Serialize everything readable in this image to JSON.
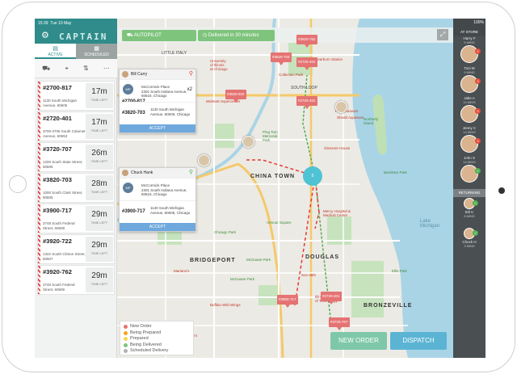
{
  "status": {
    "time": "15:39",
    "date": "Tue 10 May",
    "battery": "100%"
  },
  "brand": {
    "title": "CAPTAIN"
  },
  "tabs": [
    {
      "label": "ACTIVE"
    },
    {
      "label": "SCHEDULED"
    }
  ],
  "orders": [
    {
      "id": "#2700-817",
      "address": "1130 South Michigan Avenue, 60605",
      "mins": "17m",
      "time_left": "TIME LEFT"
    },
    {
      "id": "#2720-401",
      "address": "3700-3706 South Calumet Avenue, 60653",
      "mins": "17m",
      "time_left": "TIME LEFT"
    },
    {
      "id": "#3720-707",
      "address": "1200 South State Street, 60605",
      "mins": "26m",
      "time_left": "TIME LEFT"
    },
    {
      "id": "#3820-703",
      "address": "1000 South Clark Street, 60605",
      "mins": "28m",
      "time_left": "TIME LEFT"
    },
    {
      "id": "#3900-717",
      "address": "3748 South Federal Street, 60609",
      "mins": "29m",
      "time_left": "TIME LEFT"
    },
    {
      "id": "#3920-722",
      "address": "1322 South Clinton Street, 60607",
      "mins": "29m",
      "time_left": "TIME LEFT"
    },
    {
      "id": "#3920-762",
      "address": "3748 South Federal Street, 60609",
      "mins": "29m",
      "time_left": "TIME LEFT"
    }
  ],
  "topbar": {
    "autopilot": "AUTOPILOT",
    "delivered": "Delivered in 30 minutes"
  },
  "popovers": [
    {
      "driver": "Bill Curry",
      "rows": [
        {
          "id": "#2700-817",
          "badge": "MP",
          "place": "McCormick Place",
          "line1": "2301 South Indiana Avenue,",
          "line2": "60616, Chicago",
          "count": "x2"
        },
        {
          "id": "#3820-703",
          "badge": "",
          "place": "",
          "line1": "1130 South Michigan",
          "line2": "Avenue, 60605, Chicago",
          "count": ""
        }
      ],
      "accept": "ACCEPT"
    },
    {
      "driver": "Chuck Hank",
      "rows": [
        {
          "id": "",
          "badge": "MP",
          "place": "McCormick Place",
          "line1": "2301 South Indiana Avenue,",
          "line2": "60616, Chicago",
          "count": ""
        },
        {
          "id": "#3900-717",
          "badge": "",
          "place": "",
          "line1": "1130 South Michigan",
          "line2": "Avenue, 60605, Chicago",
          "count": ""
        }
      ],
      "accept": "ACCEPT"
    }
  ],
  "legend": [
    {
      "label": "New Order",
      "color": "#e57373"
    },
    {
      "label": "Being Prepared",
      "color": "#f5a623"
    },
    {
      "label": "Prepared",
      "color": "#f8d64e"
    },
    {
      "label": "Being Delivered",
      "color": "#7fc47d"
    },
    {
      "label": "Scheduled Delivery",
      "color": "#b0b0b0"
    }
  ],
  "map_labels": {
    "little_italy": "LITTLE ITALY",
    "south_loop": "SOUTH LOOP",
    "china_town": "CHINA TOWN",
    "bridgeport": "BRIDGEPORT",
    "douglas": "DOUGLAS",
    "bronzeville": "BRONZEVILLE",
    "lake": "Lake\nMichigan",
    "northerly_island": "Northerly\nIsland",
    "uic": "University\nof Illinois\nat Chicago",
    "ping_tom": "Ping Tom\nMemorial\nPark",
    "glessner": "Glessner House",
    "mercy": "Mercy Hospital &\nMedical Center",
    "iit": "Illinois Institute\nof Technology",
    "mcguane": "McGuane Park",
    "ellis": "Ellis Park",
    "chicago_park": "Chicago Park",
    "dearborn": "Dearborn Station",
    "collection": "Collection Park",
    "sox": "Sox-35th",
    "marianos_1": "Mariano's",
    "marianos_2": "Mariano's",
    "buffalo": "Buffalo Wild Wings",
    "walmart": "Walmart Supercenter",
    "marianos_3": "Mariano's",
    "burnham": "Burnham Park",
    "mcguane_park": "McGuane Park",
    "armour": "Armour Square",
    "museum": "Field Museum",
    "aquarium": "Shedd Aquarium"
  },
  "map_pins": [
    {
      "label": "#3920-762"
    },
    {
      "label": "#3820-703"
    },
    {
      "label": "#2720-401"
    },
    {
      "label": "#3920-922"
    },
    {
      "label": "#2720-401"
    },
    {
      "label": "#3900-717"
    },
    {
      "label": "#2720-401"
    },
    {
      "label": "#3720-707"
    }
  ],
  "store_badge": "5",
  "buttons": {
    "new_order": "NEW ORDER",
    "dispatch": "DISPATCH"
  },
  "drivers": {
    "header": "AT STORE",
    "at_store": [
      {
        "name": "Harry F",
        "mins": "5 MINS",
        "badge": "2",
        "color": "red"
      },
      {
        "name": "Toni M",
        "mins": "9 MINS",
        "badge": "3",
        "color": "red"
      },
      {
        "name": "Jake A",
        "mins": "14 MINS",
        "badge": "3",
        "color": "red"
      },
      {
        "name": "Jenny C",
        "mins": "14 MINS",
        "badge": "3",
        "color": "red"
      },
      {
        "name": "John S",
        "mins": "14 MINS",
        "badge": "0",
        "color": "green"
      }
    ],
    "returning_label": "RETURNING",
    "returning": [
      {
        "name": "Bill C",
        "mins": "8 MINS",
        "badge": "0"
      },
      {
        "name": "Chuck H",
        "mins": "3 MINS",
        "badge": "0"
      }
    ]
  }
}
